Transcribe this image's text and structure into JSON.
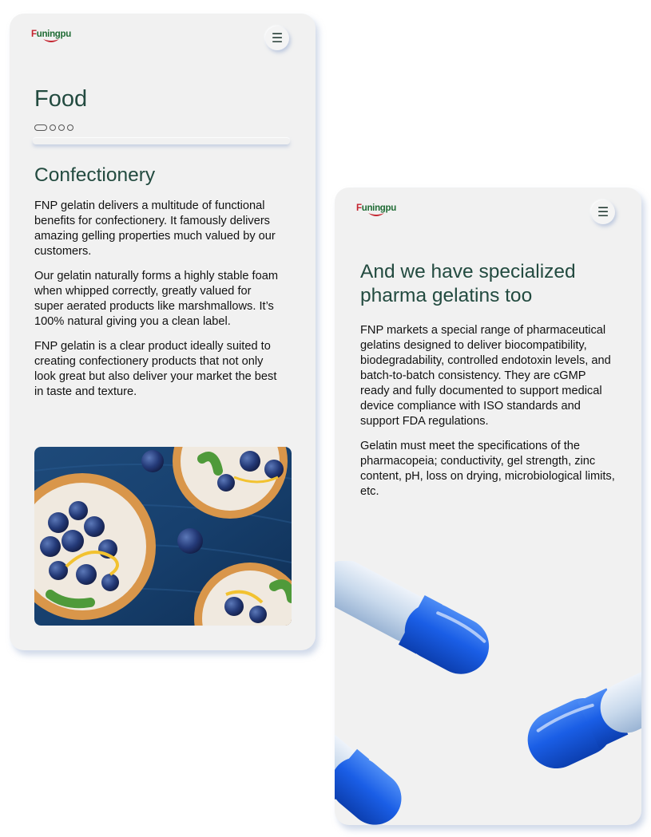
{
  "food_card": {
    "logo": "Funingpu",
    "menu_icon": "☰",
    "page_title": "Food",
    "carousel": {
      "total": 4,
      "active": 1
    },
    "section_title": "Confectionery",
    "paragraphs": [
      "FNP gelatin delivers a multitude of functional benefits for confectionery. It famously delivers amazing gelling properties much valued by our customers.",
      "Our gelatin naturally forms a highly stable foam when whipped correctly, greatly valued for super aerated products like marshmallows. It’s 100% natural giving you a clean label.",
      "FNP gelatin is a clear product ideally suited to creating confectionery products that not only look great but also deliver your market the best in taste and texture."
    ]
  },
  "pharma_card": {
    "logo": "Funingpu",
    "menu_icon": "☰",
    "title": "And we have specialized pharma gelatins too",
    "paragraphs": [
      "FNP markets a special range of pharmaceutical gelatins designed to deliver biocompatibility, biodegradability, controlled endotoxin levels, and batch-to-batch consistency. They are cGMP ready and fully documented to support medical device compliance with ISO standards and support FDA regulations.",
      "Gelatin must meet the specifications of the pharmacopeia; conductivity, gel strength, zinc content, pH, loss on drying, microbiological limits, etc."
    ]
  },
  "colors": {
    "card_bg": "#f1f1f1",
    "title_green": "#234b40",
    "logo_green": "#1f6b34",
    "logo_red": "#c4232e",
    "capsule_blue": "#1a5ee6"
  }
}
